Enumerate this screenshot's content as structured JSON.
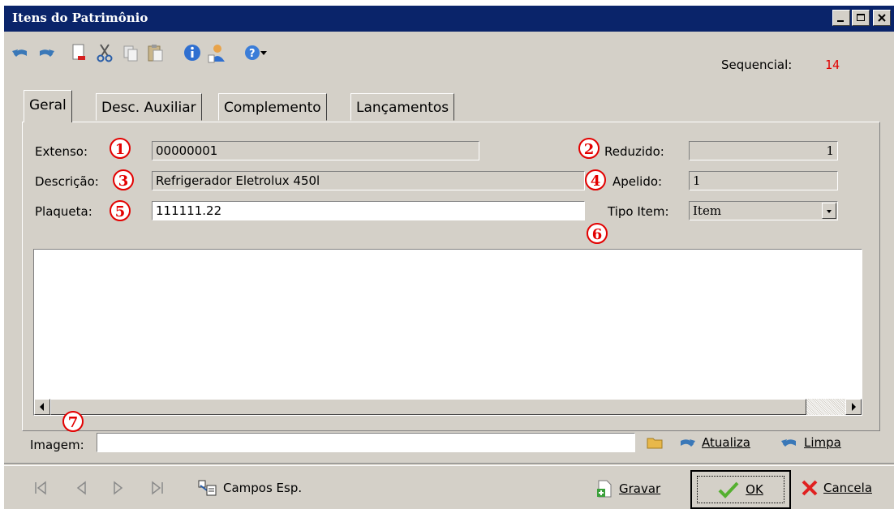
{
  "window": {
    "title": "Itens do Patrimônio"
  },
  "toolbar": {
    "sequencial_label": "Sequencial:",
    "sequencial_value": "14",
    "icons": [
      "undo-icon",
      "redo-icon",
      "new-document-icon",
      "cut-icon",
      "copy-icon",
      "paste-icon",
      "info-icon",
      "user-icon",
      "help-icon",
      "dropdown-arrow-icon"
    ]
  },
  "tabs": [
    {
      "label": "Geral",
      "active": true
    },
    {
      "label": "Desc. Auxiliar",
      "active": false
    },
    {
      "label": "Complemento",
      "active": false
    },
    {
      "label": "Lançamentos",
      "active": false
    }
  ],
  "form": {
    "extenso_label": "Extenso:",
    "extenso_value": "00000001",
    "reduzido_label": "Reduzido:",
    "reduzido_value": "1",
    "descricao_label": "Descrição:",
    "descricao_value": "Refrigerador Eletrolux 450l",
    "apelido_label": "Apelido:",
    "apelido_value": "1",
    "plaqueta_label": "Plaqueta:",
    "plaqueta_value": "111111.22",
    "tipo_item_label": "Tipo Item:",
    "tipo_item_value": "Item",
    "imagem_label": "Imagem:",
    "imagem_value": ""
  },
  "badges": [
    "1",
    "2",
    "3",
    "4",
    "5",
    "6",
    "7"
  ],
  "image_actions": {
    "atualiza": "Atualiza",
    "limpa": "Limpa"
  },
  "footer": {
    "campos_esp": "Campos Esp.",
    "gravar": "Gravar",
    "ok": "OK",
    "cancela": "Cancela"
  },
  "colors": {
    "titlebar": "#0a246a",
    "badge": "#e30000",
    "sequencial": "#e00000",
    "face": "#d4d0c8"
  }
}
